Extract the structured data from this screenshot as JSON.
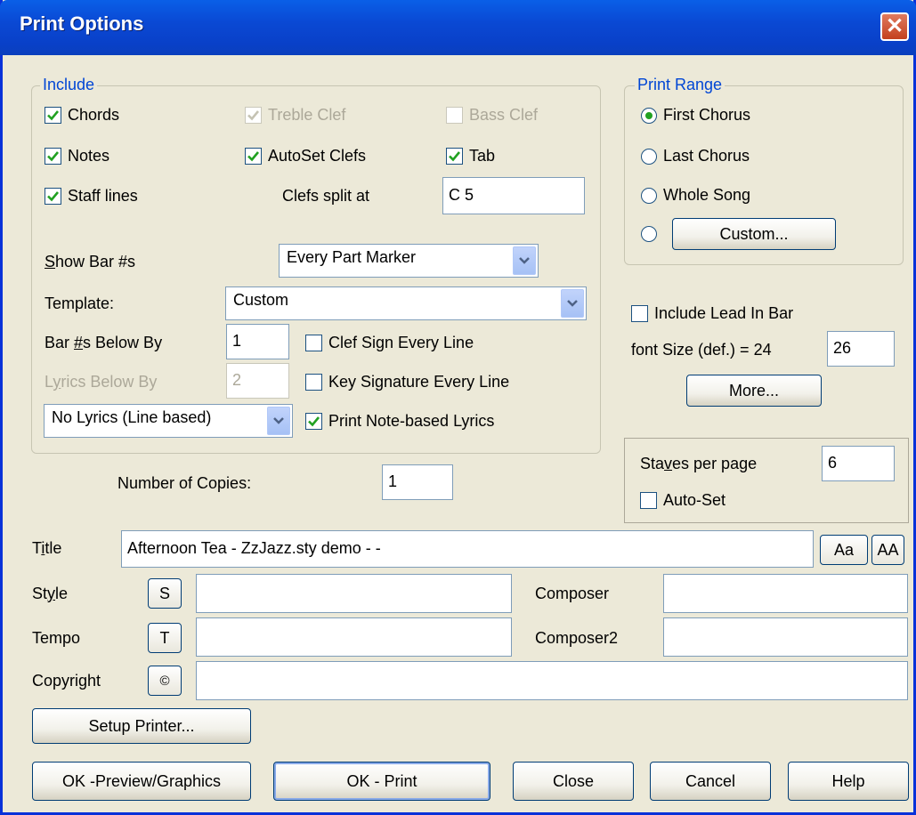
{
  "window": {
    "title": "Print Options",
    "close": "✕"
  },
  "include": {
    "legend": "Include",
    "chords": "Chords",
    "treble_clef": "Treble Clef",
    "bass_clef": "Bass Clef",
    "notes": "Notes",
    "autoset_clefs": "AutoSet Clefs",
    "tab": "Tab",
    "staff_lines": "Staff lines",
    "clefs_split_label": "Clefs split at",
    "clefs_split_value": "C 5",
    "show_bar_label_u": "S",
    "show_bar_label_rest": "how Bar #s",
    "show_bar_value": "Every Part Marker",
    "template_label": "Template:",
    "template_value": "Custom",
    "bar_below_label_a": "Bar ",
    "bar_below_label_u": "#",
    "bar_below_label_b": "s Below By",
    "bar_below_value": "1",
    "lyrics_below_label_a": "L",
    "lyrics_below_label_u": "y",
    "lyrics_below_label_b": "rics Below By",
    "lyrics_below_value": "2",
    "clef_sign": "Clef Sign Every Line",
    "key_sig": "Key Signature Every Line",
    "lyrics_mode": "No Lyrics (Line based)",
    "note_lyrics": "Print Note-based Lyrics"
  },
  "range": {
    "legend": "Print Range",
    "first": "First Chorus",
    "last": "Last Chorus",
    "whole": "Whole Song",
    "custom": "Custom..."
  },
  "right": {
    "lead_in": "Include Lead In Bar",
    "font_size_label": "font Size (def.) = 24",
    "font_size_value": "26",
    "more": "More...",
    "staves_label_a": "Sta",
    "staves_label_u": "v",
    "staves_label_b": "es per page",
    "staves_value": "6",
    "auto_set": "Auto-Set"
  },
  "copies": {
    "label": "Number of Copies:",
    "value": "1"
  },
  "fields": {
    "title_label_a": "T",
    "title_label_u": "i",
    "title_label_b": "tle",
    "title_value": "Afternoon Tea - ZzJazz.sty demo - -",
    "font_btn": "Aa",
    "caps_btn": "AA",
    "style_label_a": "St",
    "style_label_u": "y",
    "style_label_b": "le",
    "style_btn": "S",
    "tempo_label": "Tempo",
    "tempo_btn": "T",
    "copyright_label": "Copyright",
    "copyright_btn": "©",
    "composer_label": "Composer",
    "composer2_label": "Composer2"
  },
  "buttons": {
    "setup_printer": "Setup Printer...",
    "ok_preview": "OK -Preview/Graphics",
    "ok_print": "OK - Print",
    "close": "Close",
    "cancel": "Cancel",
    "help": "Help"
  },
  "colors": {
    "accent": "#0046d5",
    "check": "#21a121",
    "title_bar": "#0a49d4"
  }
}
